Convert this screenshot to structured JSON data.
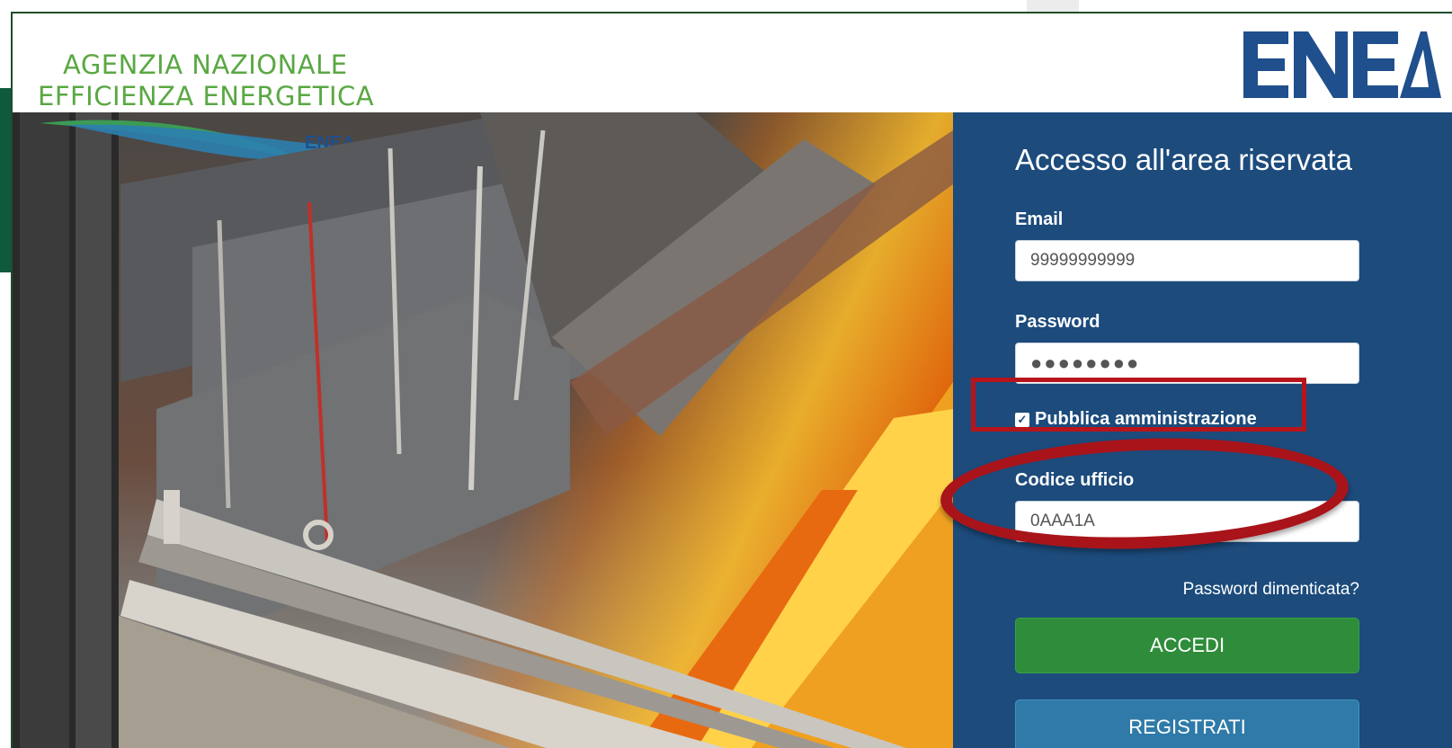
{
  "header": {
    "agency_line1": "AGENZIA NAZIONALE",
    "agency_line2": "EFFICIENZA ENERGETICA",
    "logo_text": "ENEA",
    "swoosh_text": "ENEA"
  },
  "login": {
    "title": "Accesso all'area riservata",
    "email_label": "Email",
    "email_value": "99999999999",
    "password_label": "Password",
    "password_value": "●●●●●●●●",
    "checkbox_label": "Pubblica amministrazione",
    "checkbox_checked": true,
    "office_code_label": "Codice ufficio",
    "office_code_value": "0AAA1A",
    "forgot_link": "Password dimenticata?",
    "login_button": "ACCEDI",
    "register_button": "REGISTRATI"
  },
  "colors": {
    "panel_bg": "#1c4b7c",
    "login_button_bg": "#2e8c3a",
    "register_button_bg": "#2f7aa8",
    "agency_text": "#5aa843",
    "logo_blue": "#1f4f8c",
    "annotation_red": "#b7151b"
  },
  "icons": {
    "checkbox": "checkbox-checked-icon",
    "logo": "enea-logo-icon"
  }
}
